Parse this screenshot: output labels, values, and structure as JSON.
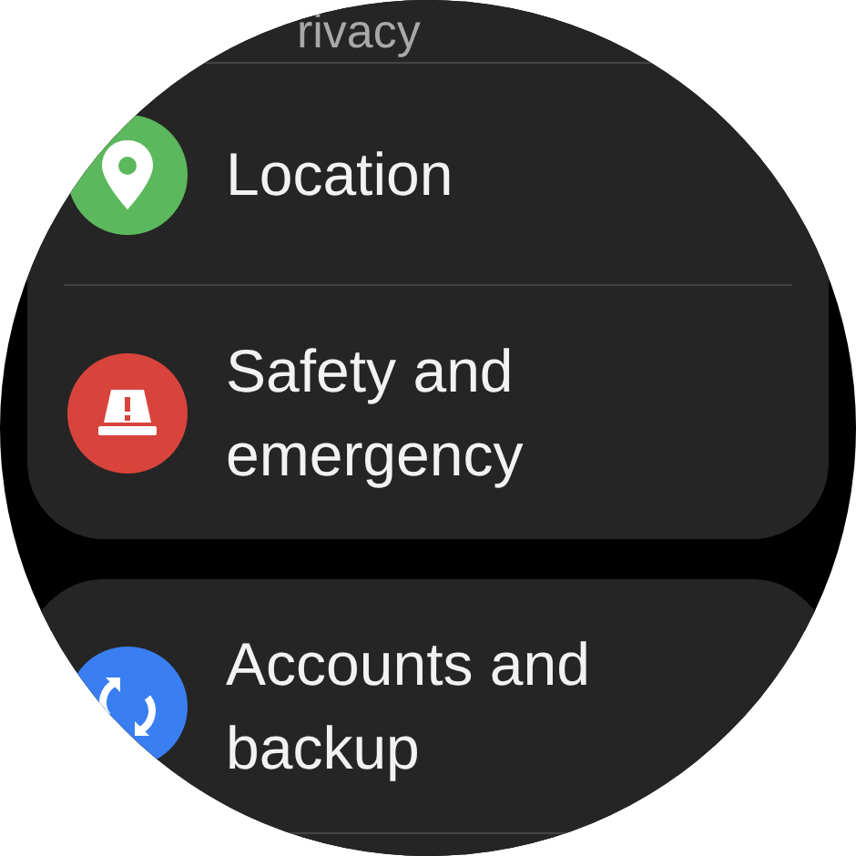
{
  "groups": [
    {
      "items": [
        {
          "label": "rivacy",
          "dimmed": true
        },
        {
          "label": "Location",
          "color": "#5cb85c",
          "dimmed": false
        },
        {
          "label": "Safety and emergency",
          "color": "#d8443b",
          "dimmed": false
        }
      ]
    },
    {
      "items": [
        {
          "label": "Accounts and backup",
          "color": "#3a7ff1",
          "dimmed": false
        }
      ]
    }
  ]
}
